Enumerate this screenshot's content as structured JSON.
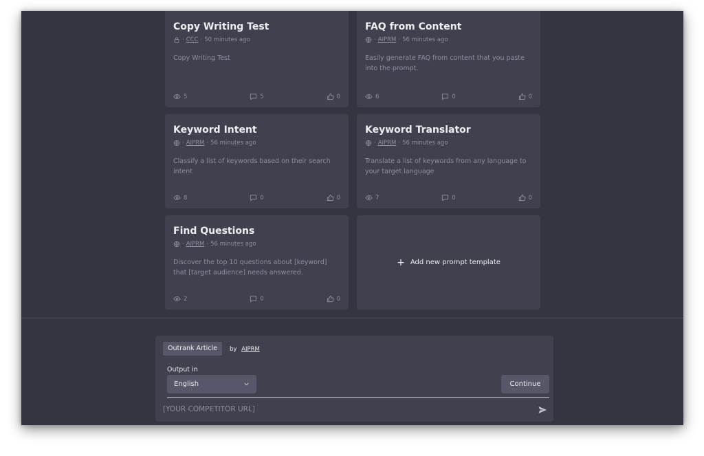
{
  "cards": [
    {
      "title": "Copy Writing Test",
      "visibility_icon": "lock-icon",
      "author": "CCC",
      "time": "50 minutes ago",
      "description": "Copy Writing Test",
      "views": "5",
      "comments": "5",
      "likes": "0"
    },
    {
      "title": "FAQ from Content",
      "visibility_icon": "globe-icon",
      "author": "AIPRM",
      "time": "56 minutes ago",
      "description": "Easily generate FAQ from content that you paste into the prompt.",
      "views": "6",
      "comments": "0",
      "likes": "0"
    },
    {
      "title": "Keyword Intent",
      "visibility_icon": "globe-icon",
      "author": "AIPRM",
      "time": "56 minutes ago",
      "description": "Classify a list of keywords based on their search intent",
      "views": "8",
      "comments": "0",
      "likes": "0"
    },
    {
      "title": "Keyword Translator",
      "visibility_icon": "globe-icon",
      "author": "AIPRM",
      "time": "56 minutes ago",
      "description": "Translate a list of keywords from any language to your target language",
      "views": "7",
      "comments": "0",
      "likes": "0"
    },
    {
      "title": "Find Questions",
      "visibility_icon": "globe-icon",
      "author": "AIPRM",
      "time": "56 minutes ago",
      "description": "Discover the top 10 questions about [keyword] that [target audience] needs answered.",
      "views": "2",
      "comments": "0",
      "likes": "0"
    }
  ],
  "meta_separator": "·",
  "add_template": {
    "icon": "plus-icon",
    "label": "Add new prompt template"
  },
  "composer": {
    "selected_template": "Outrank Article",
    "by_label": "by",
    "author": "AIPRM",
    "output_label": "Output in",
    "language": "English",
    "continue_label": "Continue",
    "input_placeholder": "[YOUR COMPETITOR URL]",
    "input_value": ""
  },
  "colors": {
    "background": "#343541",
    "card": "#40414f",
    "control": "#565869",
    "text": "#ececf1",
    "muted": "#8e8ea0"
  }
}
